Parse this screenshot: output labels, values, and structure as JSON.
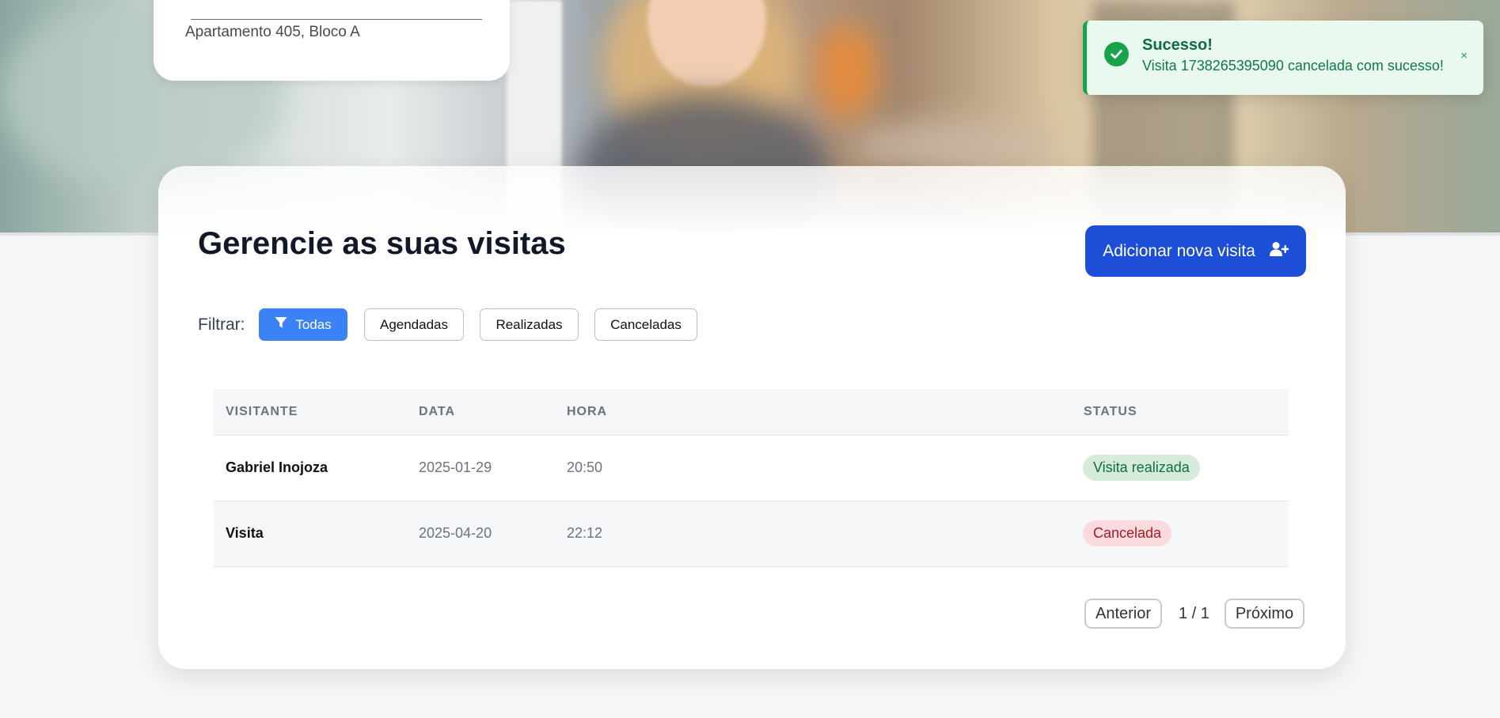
{
  "residence": {
    "address": "Apartamento 405, Bloco A"
  },
  "toast": {
    "title": "Sucesso!",
    "message": "Visita 1738265395090 cancelada com sucesso!",
    "close": "×",
    "icon": "check-circle-icon",
    "accent": "#16a34a"
  },
  "main": {
    "title": "Gerencie as suas visitas",
    "add_button": "Adicionar nova visita",
    "add_icon": "user-plus-icon",
    "accent": "#1d4ed8"
  },
  "filters": {
    "label": "Filtrar:",
    "options": [
      {
        "label": "Todas",
        "active": true,
        "icon": "filter-icon"
      },
      {
        "label": "Agendadas",
        "active": false
      },
      {
        "label": "Realizadas",
        "active": false
      },
      {
        "label": "Canceladas",
        "active": false
      }
    ]
  },
  "table": {
    "columns": [
      "VISITANTE",
      "DATA",
      "HORA",
      "STATUS"
    ],
    "rows": [
      {
        "visitor": "Gabriel Inojoza",
        "date": "2025-01-29",
        "time": "20:50",
        "status": "Visita realizada",
        "status_color": "#d5ecdc"
      },
      {
        "visitor": "Visita",
        "date": "2025-04-20",
        "time": "22:12",
        "status": "Cancelada",
        "status_color": "#fadadc"
      }
    ]
  },
  "pagination": {
    "prev": "Anterior",
    "page_info": "1 / 1",
    "next": "Próximo"
  }
}
